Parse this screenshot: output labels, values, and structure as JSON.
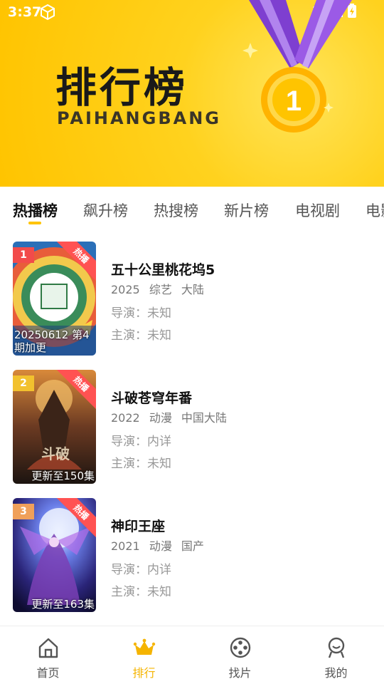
{
  "status": {
    "time": "3:37"
  },
  "banner": {
    "title": "排行榜",
    "subtitle": "PAIHANGBANG",
    "medal_number": "1"
  },
  "tabs": [
    {
      "label": "热播榜",
      "active": true
    },
    {
      "label": "飙升榜"
    },
    {
      "label": "热搜榜"
    },
    {
      "label": "新片榜"
    },
    {
      "label": "电视剧"
    },
    {
      "label": "电影"
    }
  ],
  "items": [
    {
      "rank": "1",
      "rank_color": "#f24b4b",
      "hot_label": "热播",
      "title": "五十公里桃花坞5",
      "year": "2025",
      "genre": "综艺",
      "region": "大陆",
      "director": "导演：未知",
      "actors": "主演：未知",
      "caption": "20250612 第4期加更"
    },
    {
      "rank": "2",
      "rank_color": "#f2c12e",
      "hot_label": "热播",
      "title": "斗破苍穹年番",
      "year": "2022",
      "genre": "动漫",
      "region": "中国大陆",
      "director": "导演：内详",
      "actors": "主演：未知",
      "caption": "更新至150集"
    },
    {
      "rank": "3",
      "rank_color": "#f0a05a",
      "hot_label": "热播",
      "title": "神印王座",
      "year": "2021",
      "genre": "动漫",
      "region": "国产",
      "director": "导演：内详",
      "actors": "主演：未知",
      "caption": "更新至163集"
    }
  ],
  "nav": [
    {
      "label": "首页",
      "icon": "home-icon"
    },
    {
      "label": "排行",
      "icon": "crown-icon",
      "active": true
    },
    {
      "label": "找片",
      "icon": "film-reel-icon"
    },
    {
      "label": "我的",
      "icon": "profile-icon"
    }
  ],
  "colors": {
    "accent": "#ffc400",
    "hot": "#ff5252"
  }
}
